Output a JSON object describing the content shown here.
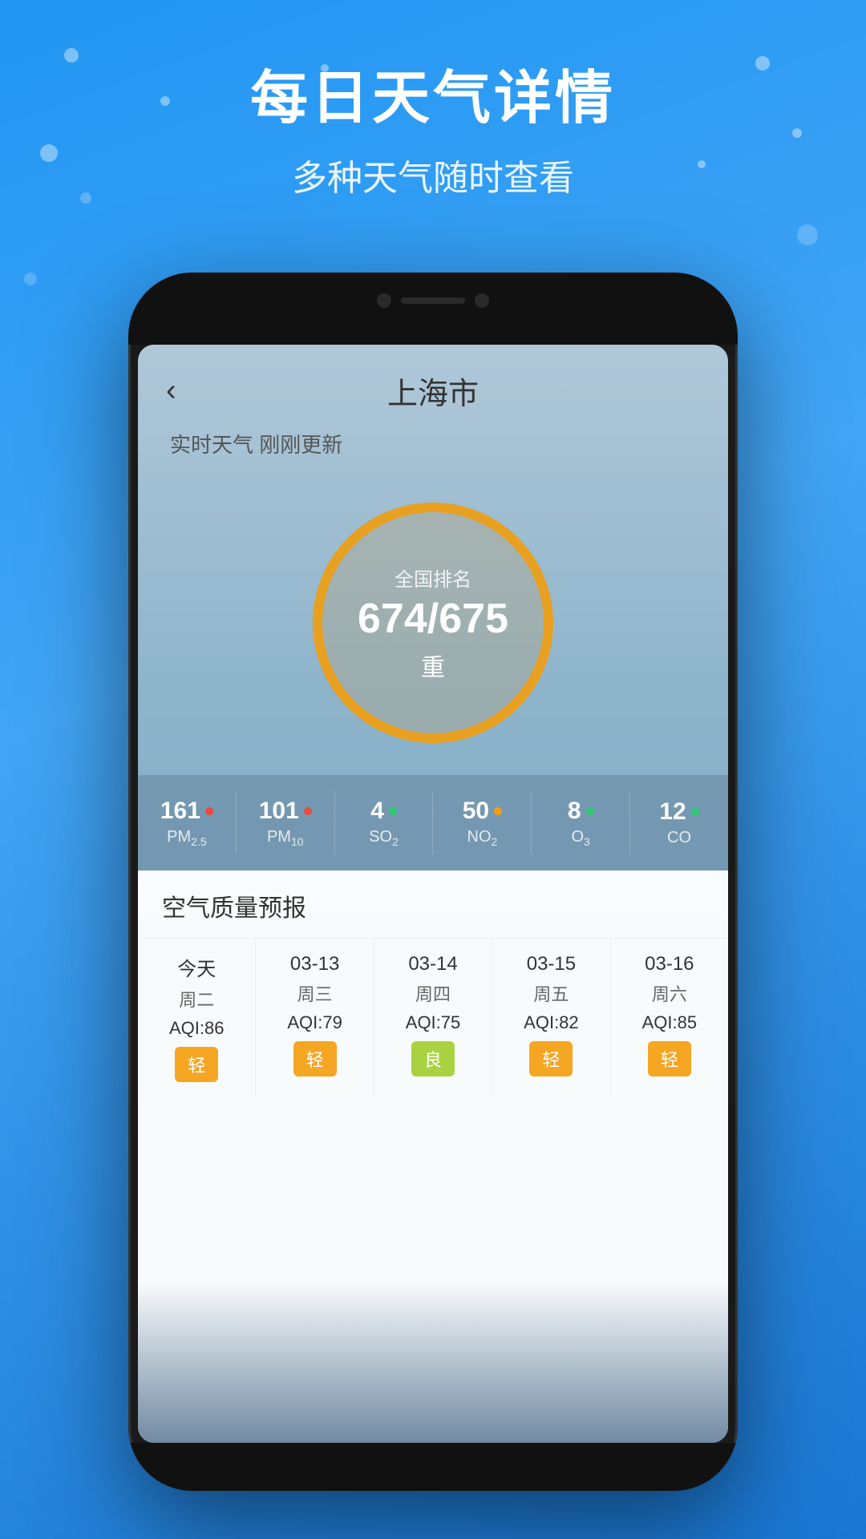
{
  "background": {
    "gradient_start": "#2196F3",
    "gradient_end": "#1976D2"
  },
  "header": {
    "title": "每日天气详情",
    "subtitle": "多种天气随时查看"
  },
  "app": {
    "back_label": "‹",
    "city": "上海市",
    "update_label": "实时天气 刚刚更新",
    "aqi_section": {
      "rank_label": "全国排名",
      "rank_value": "674/675",
      "level": "重"
    },
    "metrics": [
      {
        "value": "161",
        "name": "PM",
        "sub": "2.5",
        "dot_color": "#e74c3c"
      },
      {
        "value": "101",
        "name": "PM",
        "sub": "10",
        "dot_color": "#e74c3c"
      },
      {
        "value": "4",
        "name": "SO",
        "sub": "2",
        "dot_color": "#2ecc71"
      },
      {
        "value": "50",
        "name": "NO",
        "sub": "2",
        "dot_color": "#f39c12"
      },
      {
        "value": "8",
        "name": "O",
        "sub": "3",
        "dot_color": "#2ecc71"
      },
      {
        "value": "12",
        "name": "CO",
        "sub": "",
        "dot_color": "#2ecc71"
      }
    ],
    "forecast": {
      "title": "空气质量预报",
      "columns": [
        {
          "date": "今天",
          "day": "周二",
          "aqi": "AQI:86",
          "badge": "轻",
          "badge_class": "badge-light"
        },
        {
          "date": "03-13",
          "day": "周三",
          "aqi": "AQI:79",
          "badge": "轻",
          "badge_class": "badge-light"
        },
        {
          "date": "03-14",
          "day": "周四",
          "aqi": "AQI:75",
          "badge": "良",
          "badge_class": "badge-good"
        },
        {
          "date": "03-15",
          "day": "周五",
          "aqi": "AQI:82",
          "badge": "轻",
          "badge_class": "badge-light"
        },
        {
          "date": "03-16",
          "day": "周六",
          "aqi": "AQI:85",
          "badge": "轻",
          "badge_class": "badge-light"
        }
      ]
    }
  }
}
